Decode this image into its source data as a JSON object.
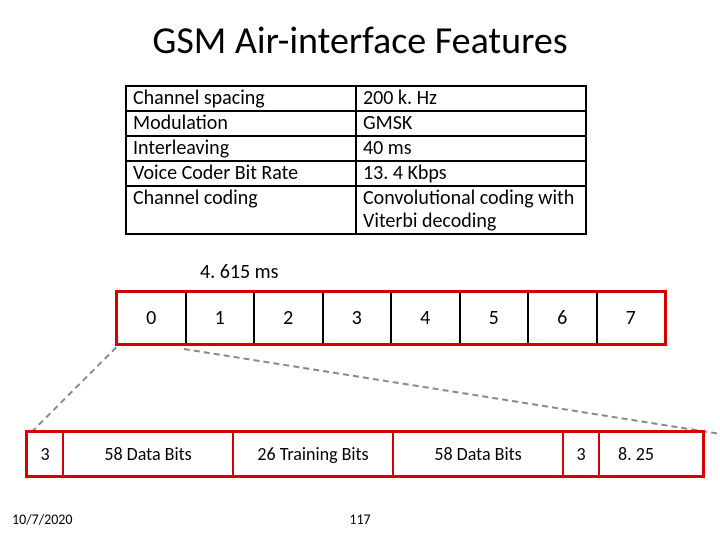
{
  "title": "GSM Air-interface Features",
  "features": [
    {
      "k": "Channel spacing",
      "v": "200 k. Hz"
    },
    {
      "k": "Modulation",
      "v": "GMSK"
    },
    {
      "k": "Interleaving",
      "v": "40 ms"
    },
    {
      "k": "Voice Coder Bit Rate",
      "v": "13. 4 Kbps"
    },
    {
      "k": "Channel coding",
      "v": "Convolutional coding with Viterbi decoding"
    }
  ],
  "frame_duration_label": "4. 615 ms",
  "slots": [
    "0",
    "1",
    "2",
    "3",
    "4",
    "5",
    "6",
    "7"
  ],
  "burst": {
    "tail1": "3",
    "data1": "58 Data Bits",
    "training": "26 Training Bits",
    "data2": "58 Data Bits",
    "tail2": "3",
    "guard": "8. 25"
  },
  "footer": {
    "date": "10/7/2020",
    "page": "117"
  }
}
